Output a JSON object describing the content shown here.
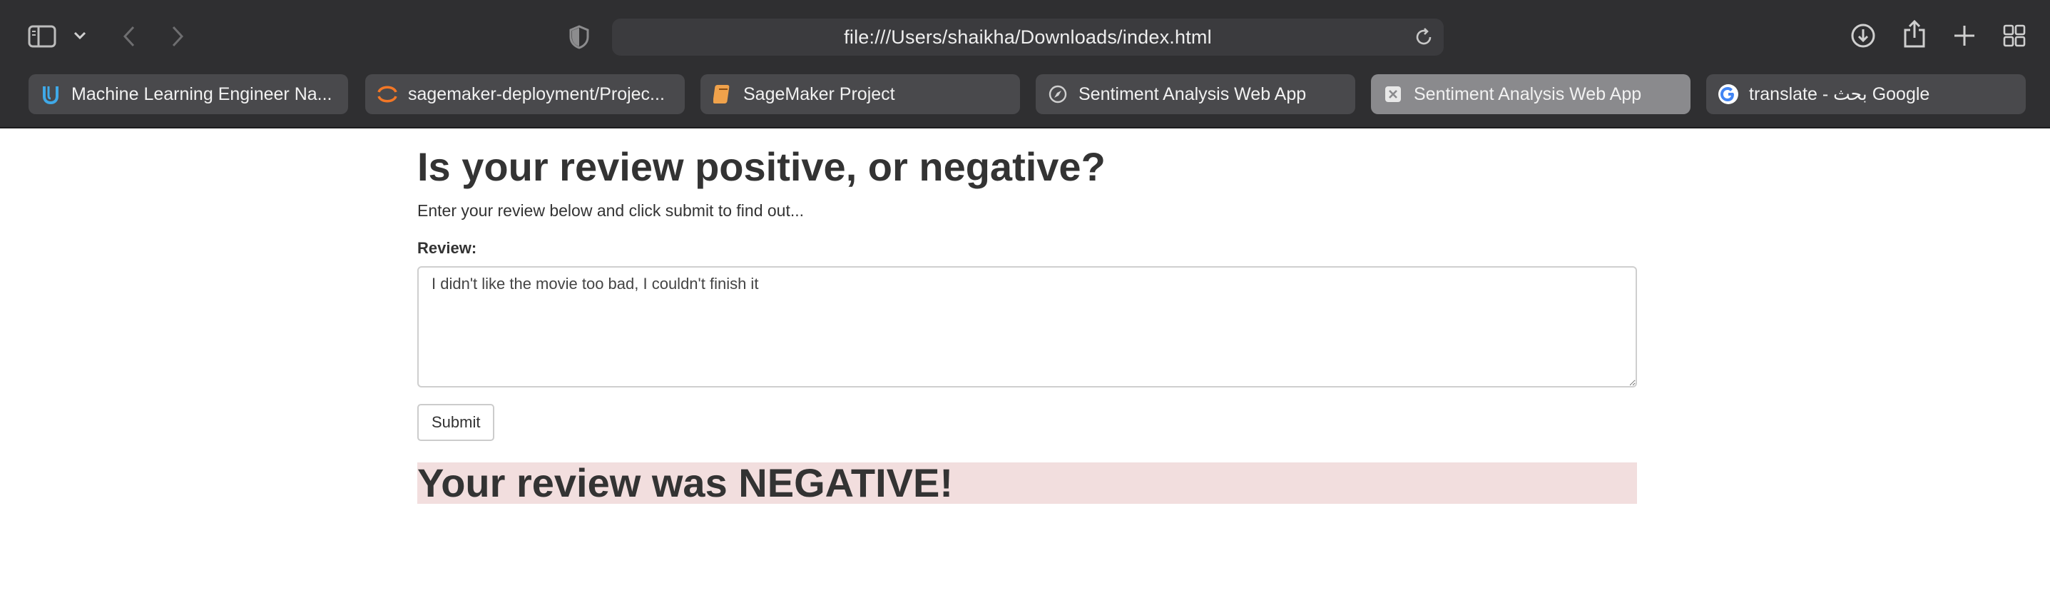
{
  "browser": {
    "url": "file:///Users/shaikha/Downloads/index.html",
    "tabs": [
      {
        "label": "Machine Learning Engineer Na...",
        "icon": "udacity-icon",
        "active": false
      },
      {
        "label": "sagemaker-deployment/Projec...",
        "icon": "jupyter-icon",
        "active": false
      },
      {
        "label": "SageMaker Project",
        "icon": "book-icon",
        "active": false
      },
      {
        "label": "Sentiment Analysis Web App",
        "icon": "compass-icon",
        "active": false
      },
      {
        "label": "Sentiment Analysis Web App",
        "icon": "close-icon",
        "active": true
      },
      {
        "label": "translate - بحث Google",
        "icon": "google-icon",
        "active": false
      }
    ],
    "colors": {
      "chrome": "#2f2f31",
      "tab": "#49494c",
      "active_tab": "#8a8a8d"
    }
  },
  "page": {
    "title": "Is your review positive, or negative?",
    "subtitle": "Enter your review below and click submit to find out...",
    "review_label": "Review:",
    "review_value": "I didn't like the movie too bad, I couldn't finish it",
    "submit_label": "Submit",
    "result": "Your review was NEGATIVE!",
    "result_color": "#f2dede"
  }
}
